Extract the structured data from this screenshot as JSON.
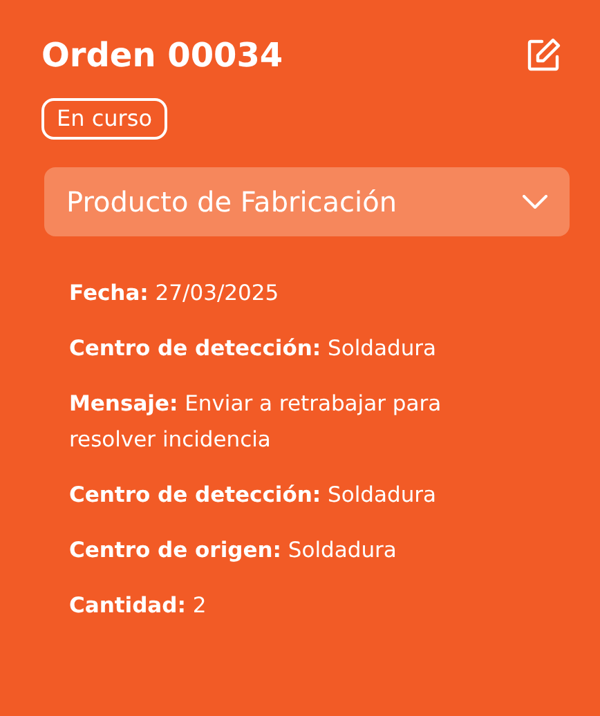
{
  "header": {
    "title": "Orden 00034",
    "status": "En curso"
  },
  "dropdown": {
    "label": "Producto de Fabricación"
  },
  "details": [
    {
      "text": "**Fecha:** 27/03/2025"
    },
    {
      "text": "**Centro de detección:** Soldadura"
    },
    {
      "text": "**Mensaje:** Enviar a retrabajar para resolver incidencia"
    },
    {
      "text": "**Centro de detección:** Soldadura"
    },
    {
      "text": "**Centro de origen:** Soldadura"
    },
    {
      "text": "**Cantidad:** 2"
    }
  ]
}
